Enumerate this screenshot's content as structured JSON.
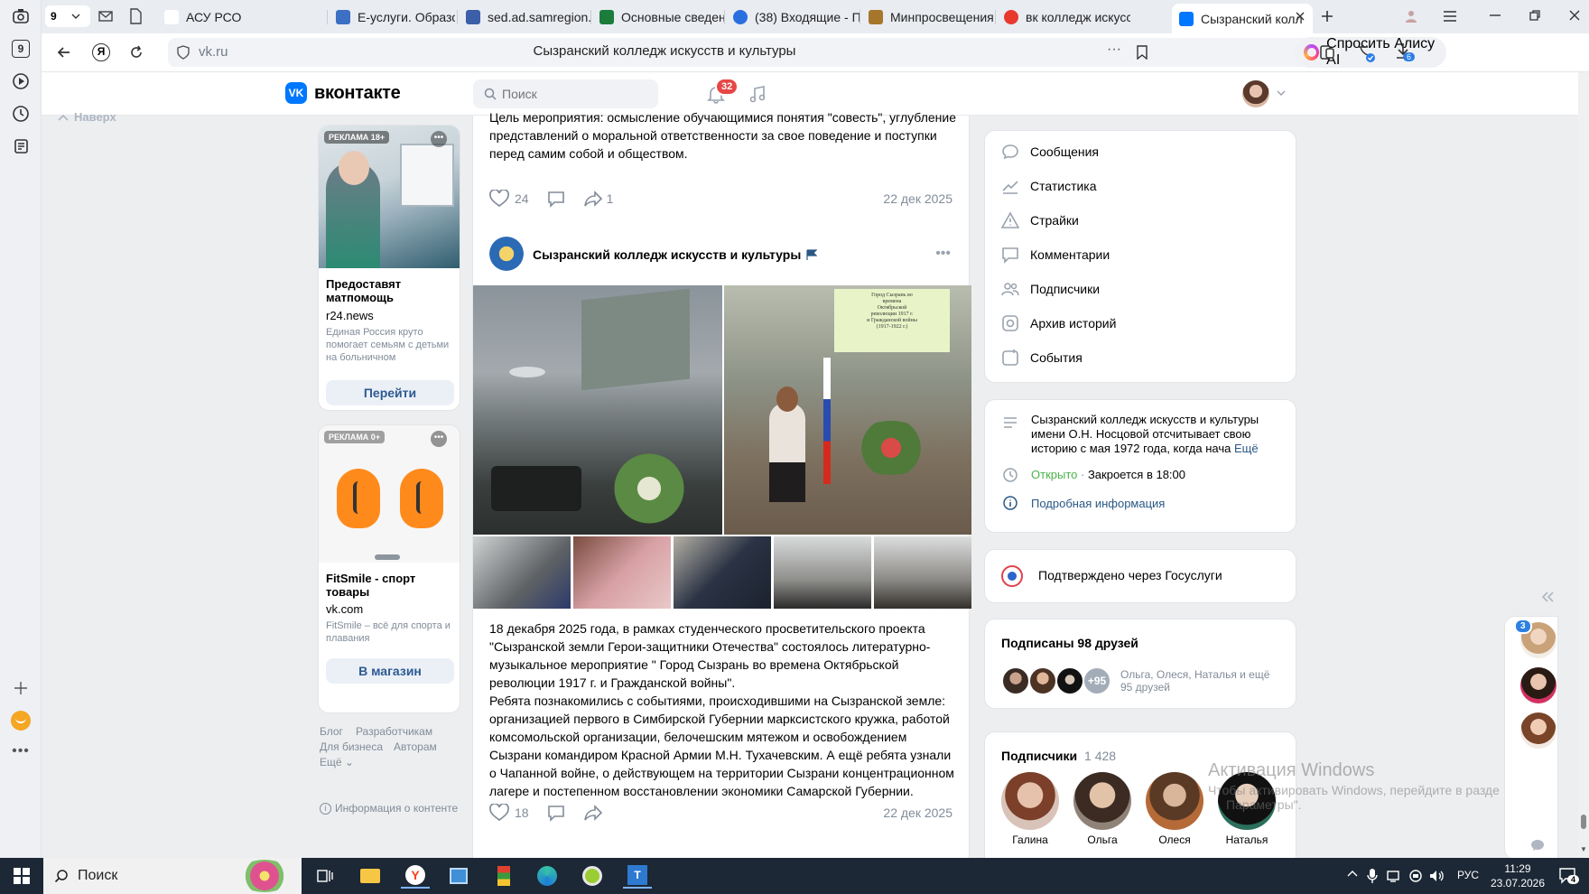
{
  "browser": {
    "tab_counter": "9",
    "tabs": [
      {
        "label": "АСУ РСО",
        "color": "#ffffff"
      },
      {
        "label": "Е-услуги. Образова",
        "color": "#3d6fc4"
      },
      {
        "label": "sed.ad.samregion.ru",
        "color": "#3b5fa8"
      },
      {
        "label": "Основные сведени",
        "color": "#1b7c3b"
      },
      {
        "label": "(38) Входящие - По",
        "color": "#2a6fe0"
      },
      {
        "label": "Минпросвещения Р",
        "color": "#a6762b"
      },
      {
        "label": "вк колледж искусст",
        "color": "#e8392f"
      },
      {
        "label": "Сызранский колл",
        "color": "#0077ff"
      }
    ],
    "url": "vk.ru",
    "page_title": "Сызранский колледж искусств и культуры",
    "alice_label": "Спросить Алису AI",
    "downloads_badge": "6"
  },
  "vk": {
    "logo_text": "вконтакте",
    "search_placeholder": "Поиск",
    "notifications_count": "32",
    "back_to_top": "Наверх"
  },
  "feed": {
    "post1": {
      "text_tail": "Цель мероприятия: осмысление обучающимися понятия \"совесть\", углубление представлений о моральной ответственности за свое поведение и поступки перед самим собой и обществом.",
      "likes": "24",
      "shares": "1",
      "date": "22 дек 2025"
    },
    "post2": {
      "author": "Сызранский колледж искусств и культуры",
      "photo_caption_lines": [
        "Город Сызрань во",
        "времена",
        "Октябрьской",
        "революции 1917 г.",
        "и Гражданской войны",
        "(1917-1922 г.)"
      ],
      "text_p1": "18 декабря 2025 года, в рамках студенческого просветительского проекта \"Сызранской земли Герои-защитники Отечества\" состоялось литературно-музыкальное мероприятие \" Город Сызрань во времена Октябрьской революции 1917 г. и Гражданской войны\".",
      "text_p2": "Ребята познакомились с событиями, происходившими на Сызранской земле: организацией первого в Симбирской Губернии марксистского кружка, работой комсомольской организации, белочешским мятежом и освобождением Сызрани командиром Красной Армии М.Н. Тухачевским. А ещё ребята узнали о Чапанной войне, о действующем на территории Сызрани концентрационном лагере и постепенном восстановлении экономики Самарской Губернии.",
      "likes": "18",
      "date": "22 дек 2025"
    }
  },
  "ads": [
    {
      "badge": "РЕКЛАМА 18+",
      "title": "Предоставят матпомощь",
      "domain": "r24.news",
      "desc": "Единая Россия круто помогает семьям с детьми на больничном",
      "button": "Перейти"
    },
    {
      "badge": "РЕКЛАМА 0+",
      "title": "FitSmile - спорт товары",
      "domain": "vk.com",
      "desc": "FitSmile – всё для спорта и плавания",
      "button": "В магазин"
    }
  ],
  "footer_links": [
    "Блог",
    "Разработчикам",
    "Для бизнеса",
    "Авторам",
    "Ещё"
  ],
  "content_info": "Информация о контенте",
  "menu": [
    {
      "label": "Сообщения",
      "icon": "message-icon"
    },
    {
      "label": "Статистика",
      "icon": "stats-icon"
    },
    {
      "label": "Страйки",
      "icon": "warning-icon"
    },
    {
      "label": "Комментарии",
      "icon": "comment-icon"
    },
    {
      "label": "Подписчики",
      "icon": "users-icon"
    },
    {
      "label": "Архив историй",
      "icon": "archive-icon"
    },
    {
      "label": "События",
      "icon": "events-icon"
    }
  ],
  "about": {
    "description": "Сызранский колледж искусств и культуры имени О.Н. Носцовой отсчитывает свою историю с мая 1972 года, когда нача",
    "more": "Ещё",
    "status_open": "Открыто",
    "status_close": "Закроется в 18:00",
    "details": "Подробная информация"
  },
  "gosuslugi": {
    "text": "Подтверждено через Госуслуги"
  },
  "friends": {
    "title": "Подписаны 98 друзей",
    "more_badge": "+95",
    "names": "Ольга, Олеся, Наталья и ещё 95 друзей"
  },
  "subscribers": {
    "title": "Подписчики",
    "count": "1 428",
    "people": [
      "Галина",
      "Ольга",
      "Олеся",
      "Наталья"
    ]
  },
  "chat_badge": "3",
  "watermark": {
    "line1": "Активация Windows",
    "line2": "Чтобы активировать Windows, перейдите в разде",
    "line3": "Параметры\"."
  },
  "taskbar": {
    "search": "Поиск",
    "lang": "РУС",
    "time": "11:29",
    "date": "23.07.2026",
    "notif_badge": "4"
  },
  "colors": {
    "vk_blue": "#0077ff",
    "badge_red": "#e64646",
    "link": "#2a5885"
  }
}
